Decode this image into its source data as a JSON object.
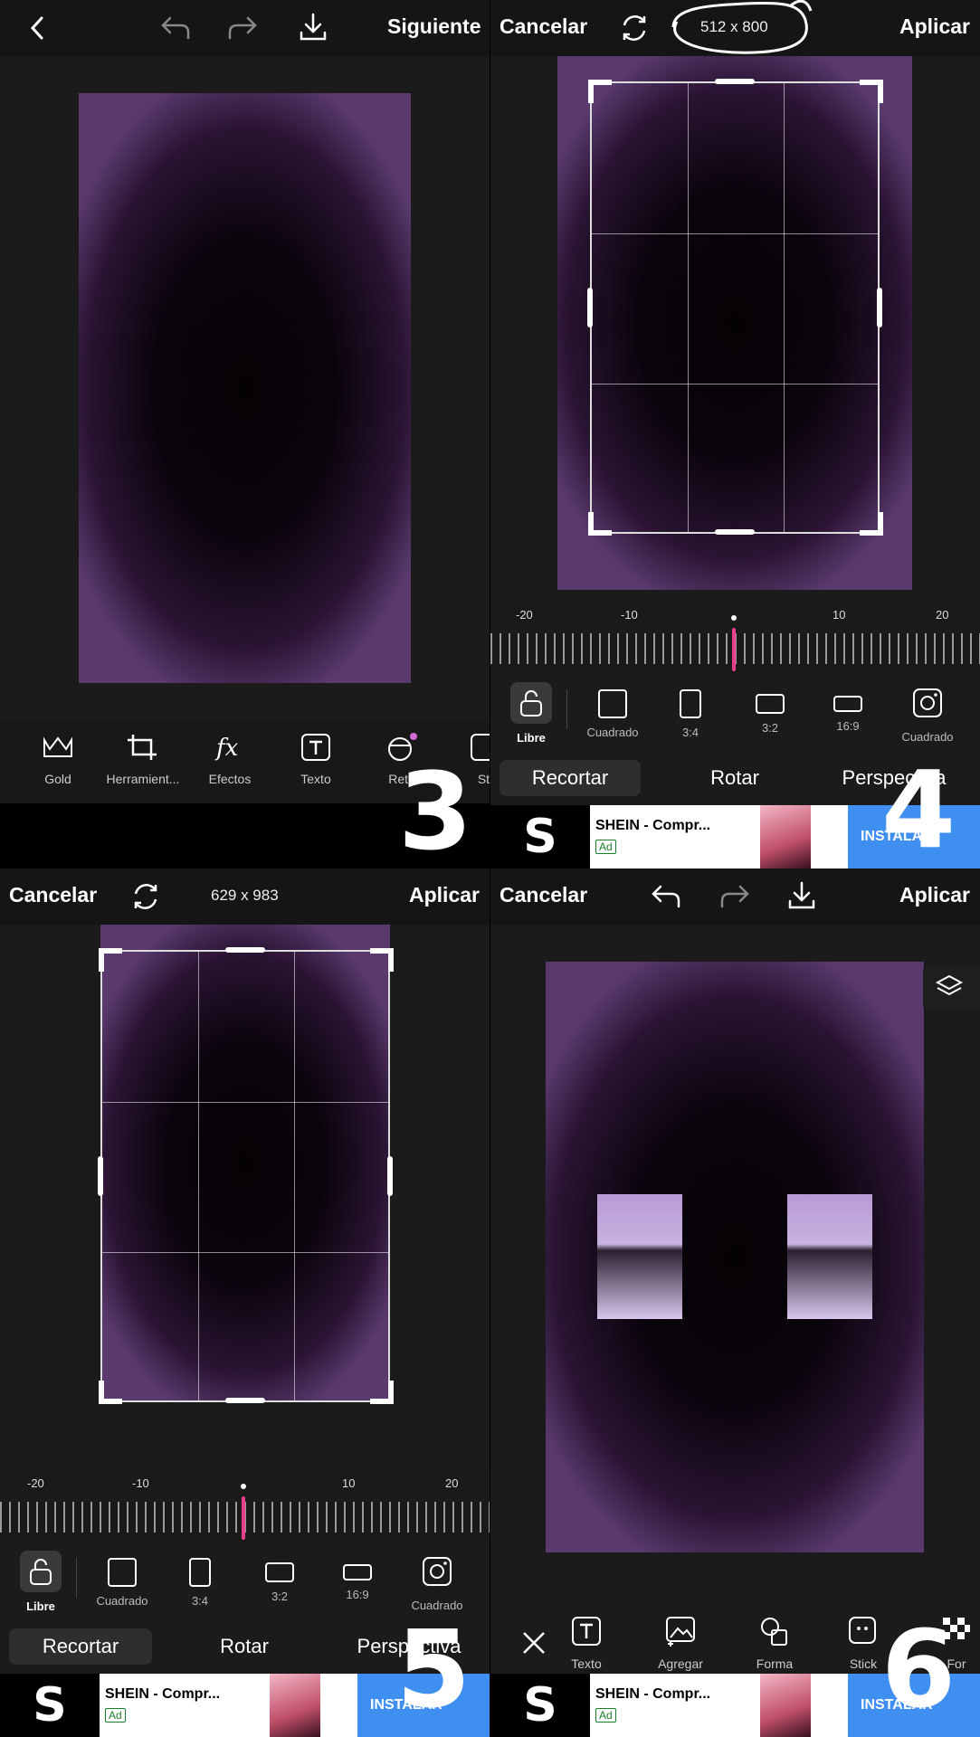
{
  "panel3": {
    "next_label": "Siguiente",
    "tools": [
      {
        "label": "Gold",
        "icon": "crown-icon"
      },
      {
        "label": "Herramient...",
        "icon": "crop-icon"
      },
      {
        "label": "Efectos",
        "icon": "fx-icon"
      },
      {
        "label": "Texto",
        "icon": "text-icon"
      },
      {
        "label": "Reto",
        "icon": "retouch-icon"
      },
      {
        "label": "Sti",
        "icon": "sticker-icon"
      }
    ],
    "step": "3"
  },
  "panel4": {
    "cancel_label": "Cancelar",
    "apply_label": "Aplicar",
    "dimensions": "512 x 800",
    "ruler_labels": [
      "-20",
      "-10",
      "10",
      "20"
    ],
    "ratios": [
      {
        "label": "Libre",
        "icon": "lock-open-icon"
      },
      {
        "label": "Cuadrado"
      },
      {
        "label": "3:4"
      },
      {
        "label": "3:2"
      },
      {
        "label": "16:9"
      },
      {
        "label": "Cuadrado",
        "icon": "instagram-icon"
      }
    ],
    "tabs": [
      "Recortar",
      "Rotar",
      "Perspectiva"
    ],
    "step": "4"
  },
  "panel5": {
    "cancel_label": "Cancelar",
    "apply_label": "Aplicar",
    "dimensions": "629 x 983",
    "ruler_labels": [
      "-20",
      "-10",
      "10",
      "20"
    ],
    "ratios": [
      {
        "label": "Libre",
        "icon": "lock-open-icon"
      },
      {
        "label": "Cuadrado"
      },
      {
        "label": "3:4"
      },
      {
        "label": "3:2"
      },
      {
        "label": "16:9"
      },
      {
        "label": "Cuadrado",
        "icon": "instagram-icon"
      }
    ],
    "tabs": [
      "Recortar",
      "Rotar",
      "Perspectiva"
    ],
    "step": "5"
  },
  "panel6": {
    "cancel_label": "Cancelar",
    "apply_label": "Aplicar",
    "tools": [
      {
        "label": "Texto",
        "icon": "text-icon"
      },
      {
        "label": "Agregar",
        "icon": "add-image-icon"
      },
      {
        "label": "Forma",
        "icon": "shape-icon"
      },
      {
        "label": "Stick",
        "icon": "sticker-icon"
      },
      {
        "label": "For",
        "icon": "checker-icon"
      }
    ],
    "step": "6"
  },
  "ad": {
    "title": "SHEIN - Compr...",
    "badge": "Ad",
    "install": "INSTALAR",
    "logo": "S"
  },
  "colors": {
    "accent_pink": "#e83e8c",
    "ad_blue": "#3f8ff0",
    "canvas_purple": "#5a3a6e"
  }
}
